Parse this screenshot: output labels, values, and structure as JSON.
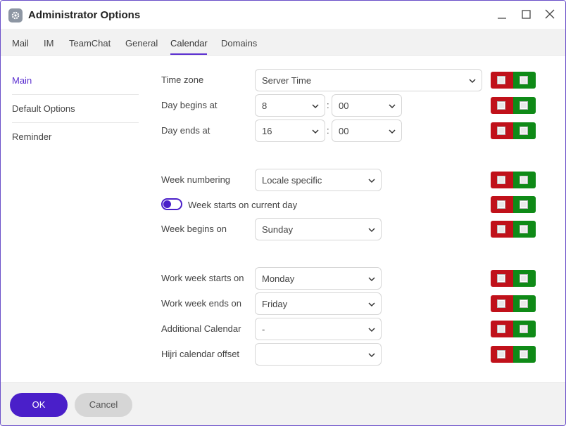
{
  "window": {
    "title": "Administrator Options"
  },
  "tabs": [
    {
      "label": "Mail"
    },
    {
      "label": "IM"
    },
    {
      "label": "TeamChat"
    },
    {
      "label": "General"
    },
    {
      "label": "Calendar",
      "active": true
    },
    {
      "label": "Domains"
    }
  ],
  "sidebar": {
    "items": [
      {
        "label": "Main",
        "active": true
      },
      {
        "label": "Default Options"
      },
      {
        "label": "Reminder"
      }
    ]
  },
  "form": {
    "time_zone": {
      "label": "Time zone",
      "value": "Server Time"
    },
    "day_begins": {
      "label": "Day begins at",
      "hour": "8",
      "minute": "00",
      "separator": ":"
    },
    "day_ends": {
      "label": "Day ends at",
      "hour": "16",
      "minute": "00",
      "separator": ":"
    },
    "week_numbering": {
      "label": "Week numbering",
      "value": "Locale specific"
    },
    "week_starts_current": {
      "label": "Week starts on current day",
      "enabled": true
    },
    "week_begins": {
      "label": "Week begins on",
      "value": "Sunday"
    },
    "work_week_starts": {
      "label": "Work week starts on",
      "value": "Monday"
    },
    "work_week_ends": {
      "label": "Work week ends on",
      "value": "Friday"
    },
    "additional_calendar": {
      "label": "Additional Calendar",
      "value": "-"
    },
    "hijri_offset": {
      "label": "Hijri calendar offset",
      "value": ""
    }
  },
  "footer": {
    "ok_label": "OK",
    "cancel_label": "Cancel"
  },
  "colors": {
    "accent": "#4a1fc9",
    "lock_red": "#c0111a",
    "lock_green": "#0f8a17"
  }
}
